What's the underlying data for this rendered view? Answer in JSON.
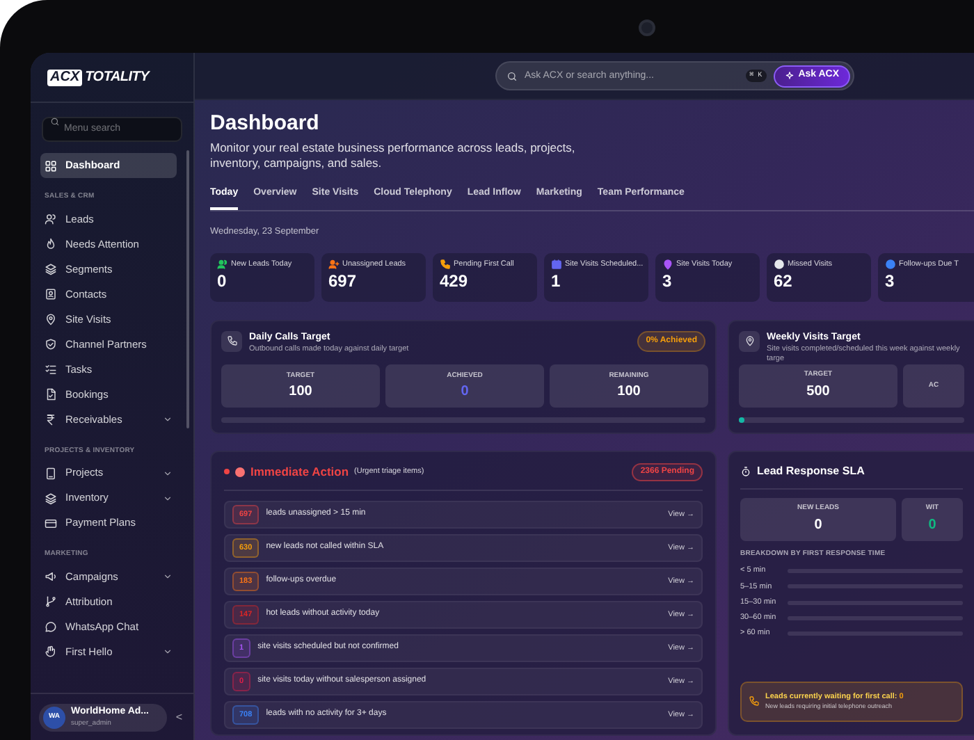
{
  "brand": {
    "mark": "ACX",
    "name": "TOTALITY"
  },
  "sidebar": {
    "search": {
      "placeholder": "Menu search"
    },
    "sections": [
      {
        "items": [
          {
            "label": "Dashboard",
            "selected": true
          }
        ]
      },
      {
        "title": "SALES & CRM",
        "items": [
          {
            "label": "Leads",
            "selected": false
          },
          {
            "label": "Needs Attention",
            "selected": false
          },
          {
            "label": "Segments",
            "selected": false
          },
          {
            "label": "Contacts",
            "selected": false
          },
          {
            "label": "Site Visits",
            "selected": false
          },
          {
            "label": "Channel Partners",
            "selected": false
          },
          {
            "label": "Tasks",
            "selected": false
          },
          {
            "label": "Bookings",
            "selected": false
          },
          {
            "label": "Receivables",
            "selected": false,
            "expandable": true
          }
        ]
      },
      {
        "title": "PROJECTS & INVENTORY",
        "items": [
          {
            "label": "Projects",
            "selected": false,
            "expandable": true
          },
          {
            "label": "Inventory",
            "selected": false,
            "expandable": true
          },
          {
            "label": "Payment Plans",
            "selected": false
          }
        ]
      },
      {
        "title": "MARKETING",
        "items": [
          {
            "label": "Campaigns",
            "selected": false,
            "expandable": true
          },
          {
            "label": "Attribution",
            "selected": false
          },
          {
            "label": "WhatsApp Chat",
            "selected": false
          },
          {
            "label": "First Hello",
            "selected": false,
            "expandable": true
          }
        ]
      }
    ],
    "user": {
      "initials": "WA",
      "name": "WorldHome Ad...",
      "role": "super_admin",
      "collapse": "<"
    }
  },
  "topbar": {
    "search": {
      "placeholder": "Ask ACX or search anything..."
    },
    "shortcut": "⌘ K",
    "ask_button": "Ask ACX"
  },
  "page": {
    "title": "Dashboard",
    "subtitle": "Monitor your real estate business performance across leads, projects, inventory, campaigns, and sales.",
    "tabs": [
      {
        "label": "Today",
        "selected": true
      },
      {
        "label": "Overview",
        "selected": false
      },
      {
        "label": "Site Visits",
        "selected": false
      },
      {
        "label": "Cloud Telephony",
        "selected": false
      },
      {
        "label": "Lead Inflow",
        "selected": false
      },
      {
        "label": "Marketing",
        "selected": false
      },
      {
        "label": "Team Performance",
        "selected": false
      }
    ],
    "date": "Wednesday, 23 September"
  },
  "stats": [
    {
      "label": "New Leads Today",
      "value": "0",
      "color": "#22c55e"
    },
    {
      "label": "Unassigned Leads",
      "value": "697",
      "color": "#f97316"
    },
    {
      "label": "Pending First Call",
      "value": "429",
      "color": "#f59e0b"
    },
    {
      "label": "Site Visits Scheduled...",
      "value": "1",
      "color": "#6366f1"
    },
    {
      "label": "Site Visits Today",
      "value": "3",
      "color": "#a855f7"
    },
    {
      "label": "Missed Visits",
      "value": "62",
      "color": "#e5e7eb"
    },
    {
      "label": "Follow-ups Due T",
      "value": "3",
      "color": "#3b82f6"
    }
  ],
  "targets": [
    {
      "title": "Daily Calls Target",
      "subtitle": "Outbound calls made today against daily target",
      "badge": "0% Achieved",
      "cells": [
        {
          "label": "TARGET",
          "value": "100"
        },
        {
          "label": "ACHIEVED",
          "value": "0"
        },
        {
          "label": "REMAINING",
          "value": "100"
        }
      ],
      "level": 0
    },
    {
      "title": "Weekly Visits Target",
      "subtitle": "Site visits completed/scheduled this week against weekly targe",
      "cells": [
        {
          "label": "TARGET",
          "value": "500"
        },
        {
          "label": "AC"
        }
      ],
      "level": 0
    }
  ],
  "immediate_action": {
    "title": "Immediate Action",
    "note": "(Urgent triage items)",
    "badge": "2366 Pending",
    "rows": [
      {
        "count": "697",
        "text": "leads unassigned > 15 min",
        "link": "View →",
        "color": "#ef4444"
      },
      {
        "count": "630",
        "text": "new leads not called within SLA",
        "link": "View →",
        "color": "#f59e0b"
      },
      {
        "count": "183",
        "text": "follow-ups overdue",
        "link": "View →",
        "color": "#f97316"
      },
      {
        "count": "147",
        "text": "hot leads without activity today",
        "link": "View →",
        "color": "#dc2626"
      },
      {
        "count": "1",
        "text": "site visits scheduled but not confirmed",
        "link": "View →",
        "color": "#a855f7"
      },
      {
        "count": "0",
        "text": "site visits today without salesperson assigned",
        "link": "View →",
        "color": "#e11d48"
      },
      {
        "count": "708",
        "text": "leads with no activity for 3+ days",
        "link": "View →",
        "color": "#3b82f6"
      }
    ]
  },
  "lead_response_sla": {
    "title": "Lead Response SLA",
    "cells": [
      {
        "label": "NEW LEADS",
        "value": "0"
      },
      {
        "label": "WIT",
        "value": "0"
      }
    ],
    "breakdown_title": "BREAKDOWN BY FIRST RESPONSE TIME",
    "breakdown": [
      {
        "label": "< 5 min",
        "level": 0
      },
      {
        "label": "5–15 min",
        "level": 0
      },
      {
        "label": "15–30 min",
        "level": 0
      },
      {
        "label": "30–60 min",
        "level": 0
      },
      {
        "label": "> 60 min",
        "level": 0
      }
    ],
    "waiting": {
      "text": "Leads currently waiting for first call:",
      "count": "0",
      "note": "New leads requiring initial telephone outreach"
    }
  }
}
